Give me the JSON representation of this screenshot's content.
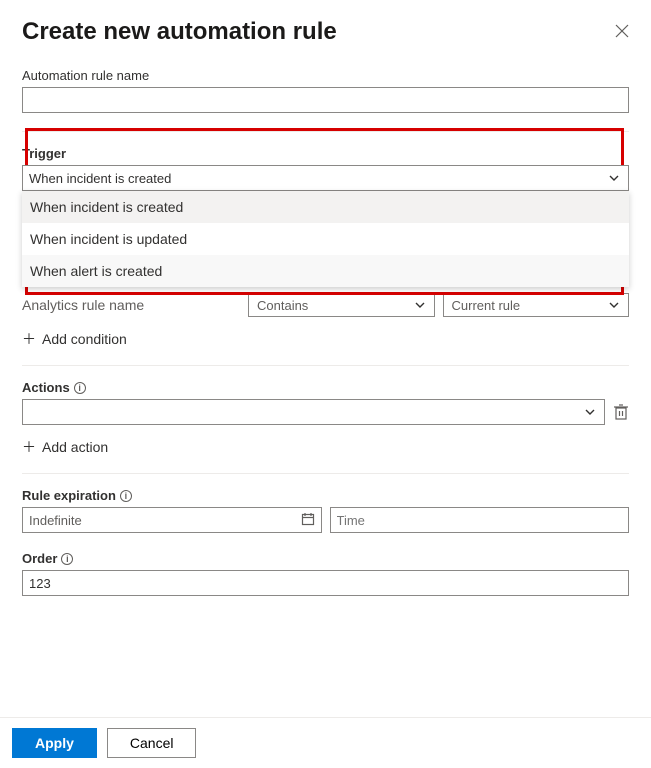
{
  "header": {
    "title": "Create new automation rule"
  },
  "name_section": {
    "label": "Automation rule name",
    "value": ""
  },
  "trigger_section": {
    "label": "Trigger",
    "selected": "When incident is created",
    "options": [
      "When incident is created",
      "When incident is updated",
      "When alert is created"
    ]
  },
  "conditions": {
    "analytics_label": "Analytics rule name",
    "operator": "Contains",
    "value": "Current rule",
    "add_label": "Add condition"
  },
  "actions_section": {
    "label": "Actions",
    "selected": "",
    "add_label": "Add action"
  },
  "expiration_section": {
    "label": "Rule expiration",
    "date_value": "Indefinite",
    "time_placeholder": "Time"
  },
  "order_section": {
    "label": "Order",
    "value": "123"
  },
  "footer": {
    "apply": "Apply",
    "cancel": "Cancel"
  }
}
